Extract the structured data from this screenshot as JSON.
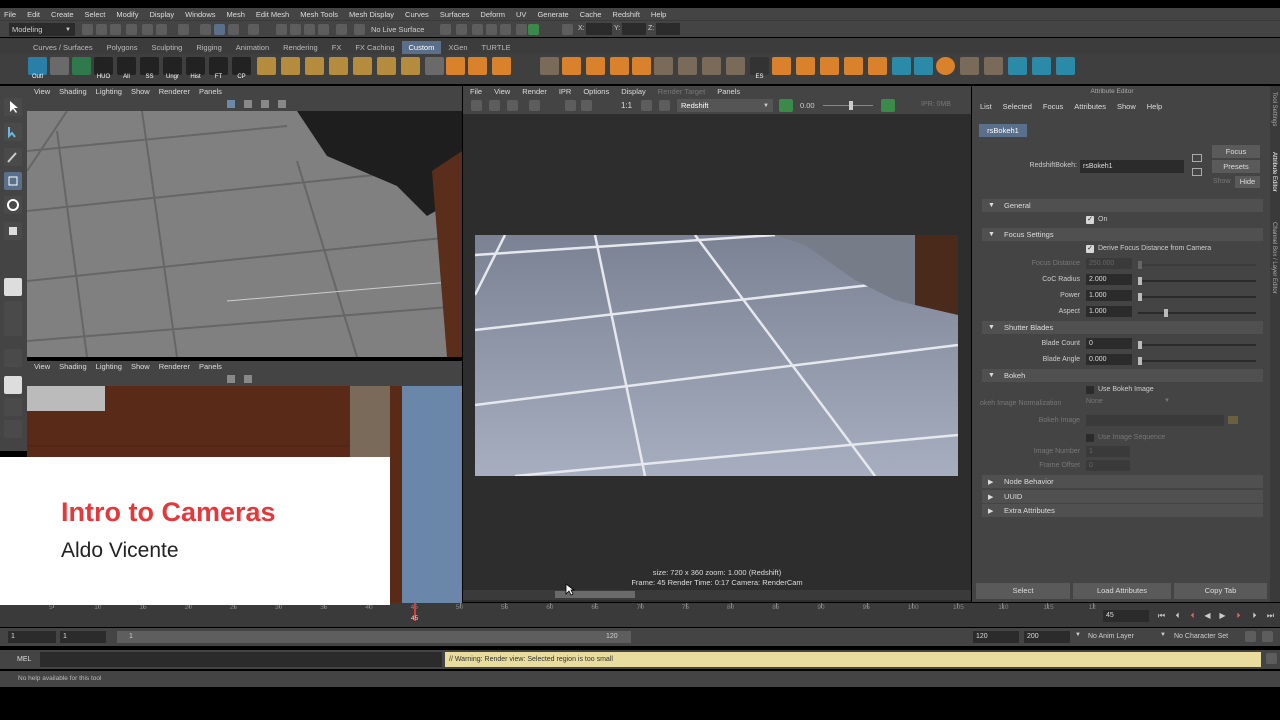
{
  "menubar": [
    "File",
    "Edit",
    "Create",
    "Select",
    "Modify",
    "Display",
    "Windows",
    "Mesh",
    "Edit Mesh",
    "Mesh Tools",
    "Mesh Display",
    "Curves",
    "Surfaces",
    "Deform",
    "UV",
    "Generate",
    "Cache",
    "Redshift",
    "Help"
  ],
  "status": {
    "mode": "Modeling",
    "live_surface": "No Live Surface",
    "x_label": "X:",
    "y_label": "Y:",
    "z_label": "Z:"
  },
  "shelf_tabs": [
    "Curves / Surfaces",
    "Polygons",
    "Sculpting",
    "Rigging",
    "Animation",
    "Rendering",
    "FX",
    "FX Caching",
    "Custom",
    "XGen",
    "TURTLE"
  ],
  "shelf_active": "Custom",
  "shelf_labels": [
    "Outl",
    "HUO",
    "All",
    "SS",
    "Ungr",
    "Hist",
    "FT",
    "CP",
    "ES"
  ],
  "viewport_menu": [
    "View",
    "Shading",
    "Lighting",
    "Show",
    "Renderer",
    "Panels"
  ],
  "render_view": {
    "menu": [
      "File",
      "View",
      "Render",
      "IPR",
      "Options",
      "Display",
      "Render Target",
      "Panels"
    ],
    "ratio": "1:1",
    "renderer": "Redshift",
    "value": "0.00",
    "ipr": "IPR: 0MB",
    "info_line1": "size: 720 x 360  zoom: 1.000        (Redshift)",
    "info_line2": "Frame: 45        Render Time: 0:17        Camera: RenderCam"
  },
  "attribute_editor": {
    "title": "Attribute Editor",
    "menu": [
      "List",
      "Selected",
      "Focus",
      "Attributes",
      "Show",
      "Help"
    ],
    "tab": "rsBokeh1",
    "node_label": "RedshiftBokeh:",
    "node_name": "rsBokeh1",
    "focus_btn": "Focus",
    "presets_btn": "Presets",
    "show_label": "Show",
    "hide_btn": "Hide",
    "sections": {
      "general": "General",
      "focus_settings": "Focus Settings",
      "shutter_blades": "Shutter Blades",
      "bokeh": "Bokeh",
      "node_behavior": "Node Behavior",
      "uuid": "UUID",
      "extra_attributes": "Extra Attributes"
    },
    "on_label": "On",
    "derive_label": "Derive Focus Distance from Camera",
    "focus_distance_label": "Focus Distance",
    "focus_distance_value": "250.000",
    "coc_label": "CoC Radius",
    "coc_value": "2.000",
    "power_label": "Power",
    "power_value": "1.000",
    "aspect_label": "Aspect",
    "aspect_value": "1.000",
    "blade_count_label": "Blade Count",
    "blade_count_value": "0",
    "blade_angle_label": "Blade Angle",
    "blade_angle_value": "0.000",
    "use_bokeh_image_label": "Use Bokeh Image",
    "norm_label": "okeh Image Normalization",
    "norm_value": "None",
    "bokeh_image_label": "Bokeh Image",
    "use_seq_label": "Use Image Sequence",
    "image_number_label": "Image Number",
    "image_number_value": "1",
    "frame_offset_label": "Frame Offset",
    "frame_offset_value": "0",
    "bottom_buttons": [
      "Select",
      "Load Attributes",
      "Copy Tab"
    ],
    "side_tabs": [
      "Tool Settings",
      "Attribute Editor",
      "Channel Box / Layer Editor"
    ]
  },
  "timeline": {
    "ticks": [
      "5",
      "10",
      "15",
      "20",
      "25",
      "30",
      "35",
      "40",
      "45",
      "50",
      "55",
      "60",
      "65",
      "70",
      "75",
      "80",
      "85",
      "90",
      "95",
      "100",
      "105",
      "110",
      "115",
      "12"
    ],
    "current": "45",
    "current_field": "45"
  },
  "range": {
    "start": "1",
    "start2": "1",
    "slider_start": "1",
    "slider_end": "120",
    "end": "120",
    "end2": "200",
    "anim_layer": "No Anim Layer",
    "char_set": "No Character Set"
  },
  "cmd": {
    "label": "MEL",
    "warning": "// Warning: Render view: Selected region is too small"
  },
  "help": "No help available for this tool",
  "overlay": {
    "title": "Intro to Cameras",
    "subtitle": "Aldo Vicente"
  },
  "colors": {
    "accent": "#e5383b",
    "maya_bg": "#444444",
    "warning_bg": "#e8dc9e",
    "shelf_active": "#5a6f8a"
  }
}
